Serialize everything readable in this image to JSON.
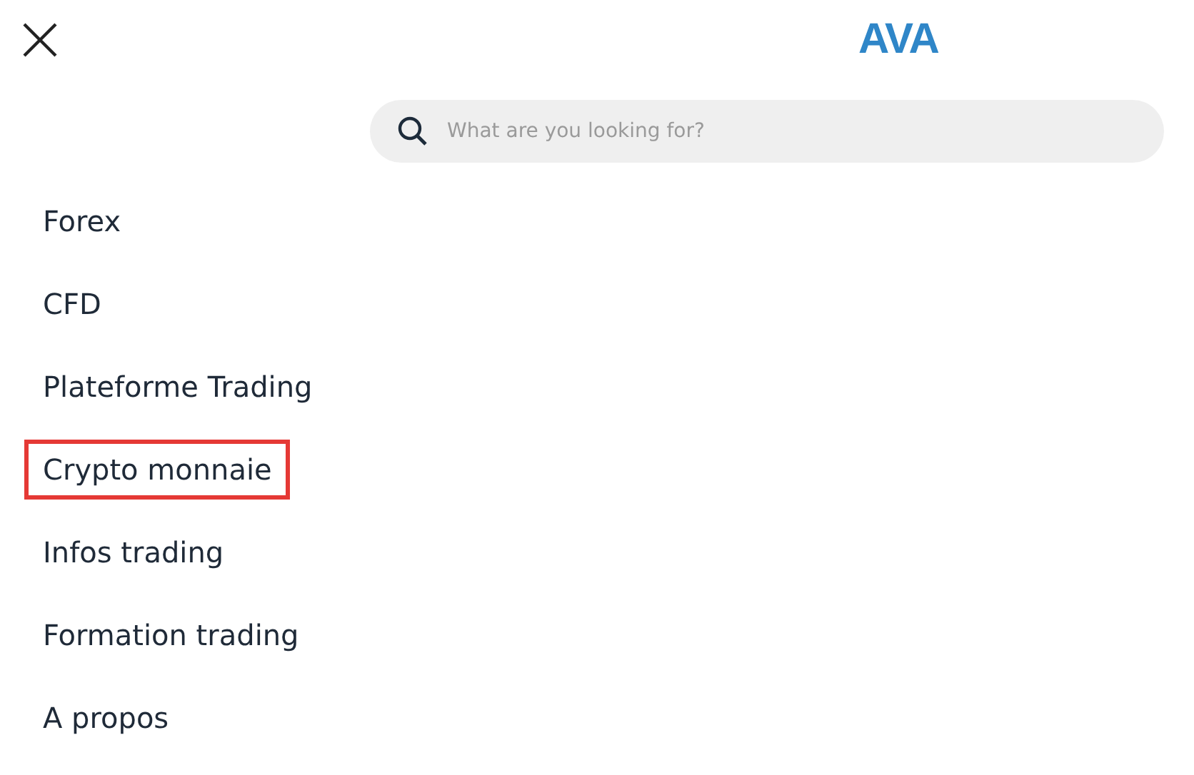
{
  "header": {
    "logo": "AVA"
  },
  "search": {
    "placeholder": "What are you looking for?"
  },
  "menu": [
    {
      "label": "Forex",
      "highlighted": false
    },
    {
      "label": "CFD",
      "highlighted": false
    },
    {
      "label": "Plateforme Trading",
      "highlighted": false
    },
    {
      "label": "Crypto monnaie",
      "highlighted": true
    },
    {
      "label": "Infos trading",
      "highlighted": false
    },
    {
      "label": "Formation trading",
      "highlighted": false
    },
    {
      "label": "A propos",
      "highlighted": false
    }
  ]
}
